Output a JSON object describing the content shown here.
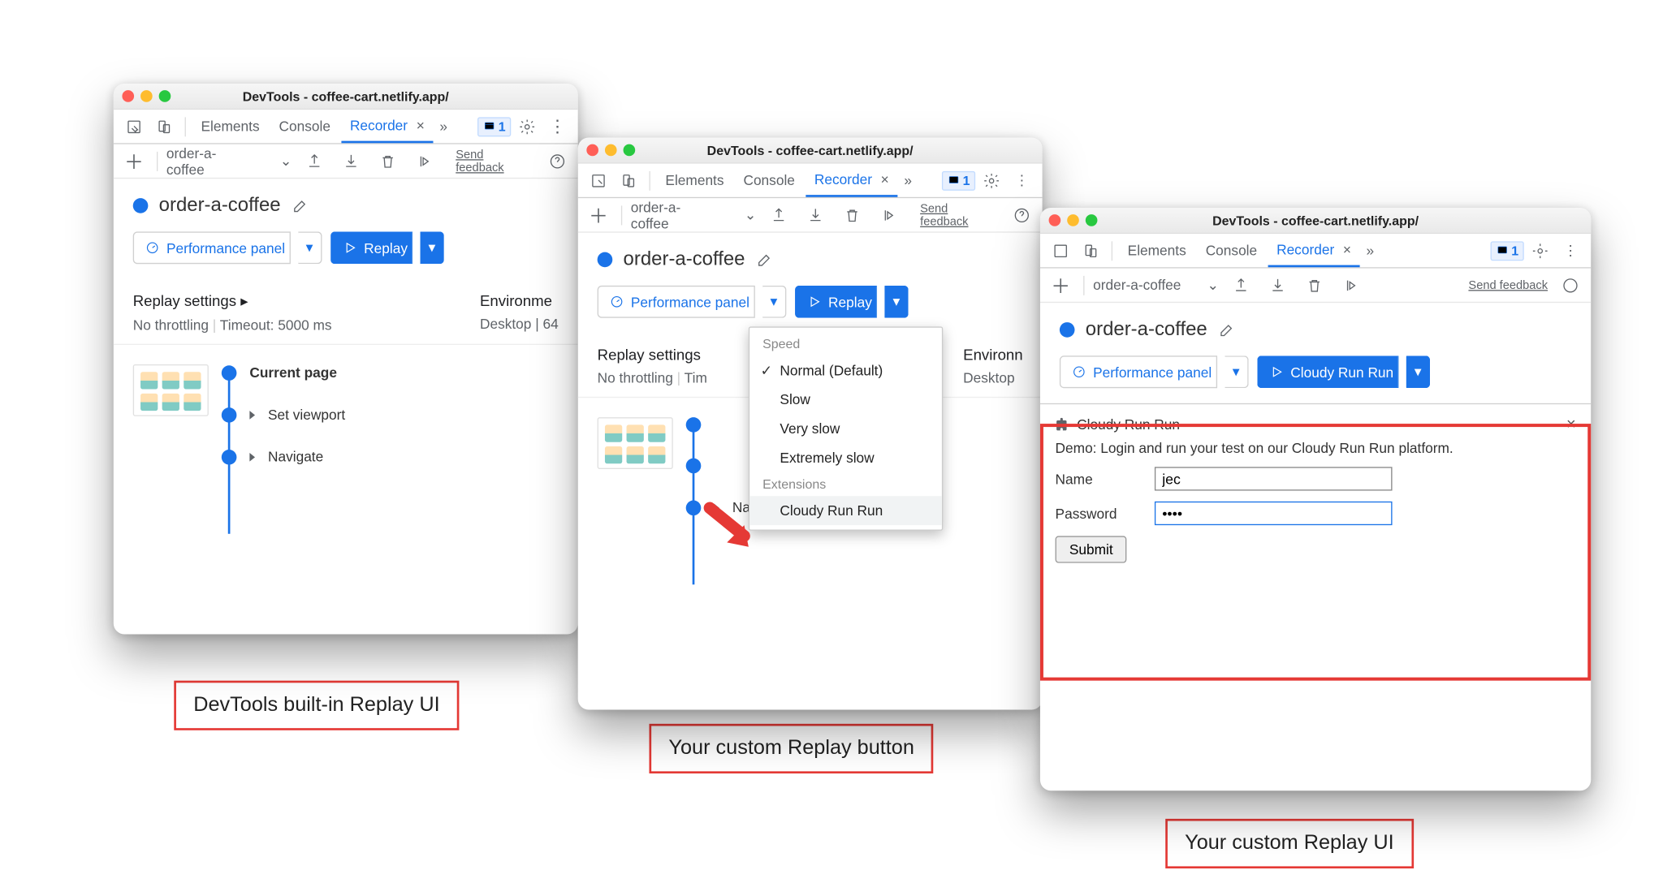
{
  "window_title": "DevTools - coffee-cart.netlify.app/",
  "tabs": {
    "elements": "Elements",
    "console": "Console",
    "recorder": "Recorder"
  },
  "issues_badge": "1",
  "recording_name": "order-a-coffee",
  "send_feedback": "Send feedback",
  "recording_header": "order-a-coffee",
  "perf_panel": "Performance panel",
  "replay": "Replay",
  "cloudy_button": "Cloudy Run Run",
  "replay_settings_label": "Replay settings",
  "no_throttling": "No throttling",
  "timeout": "Timeout: 5000 ms",
  "env_label": "Environment",
  "env_short": "Environme",
  "env_shorter": "Environn",
  "desktop": "Desktop",
  "desktop_full": "Desktop | 64",
  "steps": {
    "current": "Current page",
    "viewport": "Set viewport",
    "navigate": "Navigate"
  },
  "dropdown": {
    "speed": "Speed",
    "normal": "Normal (Default)",
    "slow": "Slow",
    "very_slow": "Very slow",
    "extremely_slow": "Extremely slow",
    "extensions": "Extensions",
    "cloudy": "Cloudy Run Run"
  },
  "drawer": {
    "title": "Cloudy Run Run",
    "desc": "Demo: Login and run your test on our Cloudy Run Run platform.",
    "name_label": "Name",
    "name_value": "jec",
    "pwd_label": "Password",
    "pwd_value": "••••",
    "submit": "Submit"
  },
  "captions": {
    "c1": "DevTools built-in Replay UI",
    "c2": "Your custom Replay button",
    "c3": "Your custom Replay UI"
  }
}
